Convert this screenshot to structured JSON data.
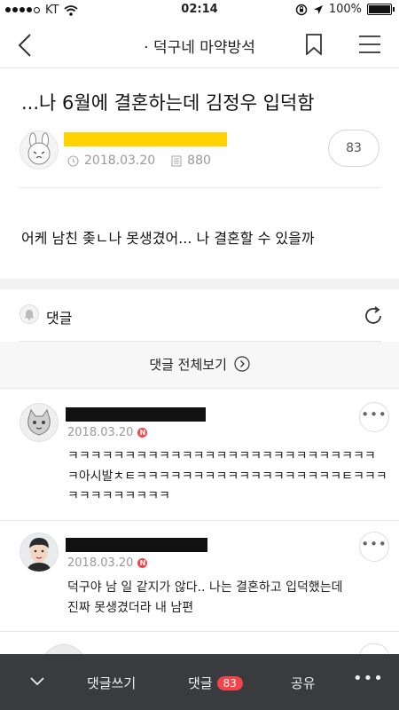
{
  "status_bar": {
    "carrier": "KT",
    "time": "02:14",
    "battery": "100%"
  },
  "nav": {
    "title": "· 덕구네 마약방석",
    "icons": [
      "back-arrow-icon",
      "bookmark-icon",
      "menu-icon"
    ]
  },
  "post": {
    "title": "...나 6월에 결혼하는데 김정우 입덕함",
    "date": "2018.03.20",
    "views": "880",
    "comment_count": "83",
    "body": "어케 남친 좆ㄴ나 못생겼어... 나 결혼할 수 있을까"
  },
  "comments_section": {
    "label": "댓글",
    "view_all": "댓글 전체보기"
  },
  "comments": [
    {
      "date": "2018.03.20",
      "new_badge": "N",
      "lines": [
        "ㅋㅋㅋㅋㅋㅋㅋㅋㅋㅋㅋㅋㅋㅋㅋㅋㅋㅋㅋㅋㅋㅋㅋㅋㅋㅋㅋ",
        "ㅋ아시발ㅊㅌㅋㅋㅋㅋㅋㅋㅋㅋㅋㅋㅋㅋㅋㅋㅋㅋㅋㅋㅌㅋㅋㅋ",
        "ㅋㅋㅋㅋㅋㅋㅋㅋㅋ"
      ]
    },
    {
      "date": "2018.03.20",
      "new_badge": "N",
      "lines": [
        "덕구야 남 일 같지가 않다.. 나는 결혼하고 입덕했는데",
        "진짜 못생겼더라 내 남편"
      ]
    }
  ],
  "bottom_bar": {
    "write_label": "댓글쓰기",
    "comments_label": "댓글",
    "comments_count": "83",
    "share_label": "공유"
  },
  "colors": {
    "accent_red": "#f2454a",
    "author_highlight": "#ffd200",
    "bottom_bar": "#3a3b3f"
  }
}
